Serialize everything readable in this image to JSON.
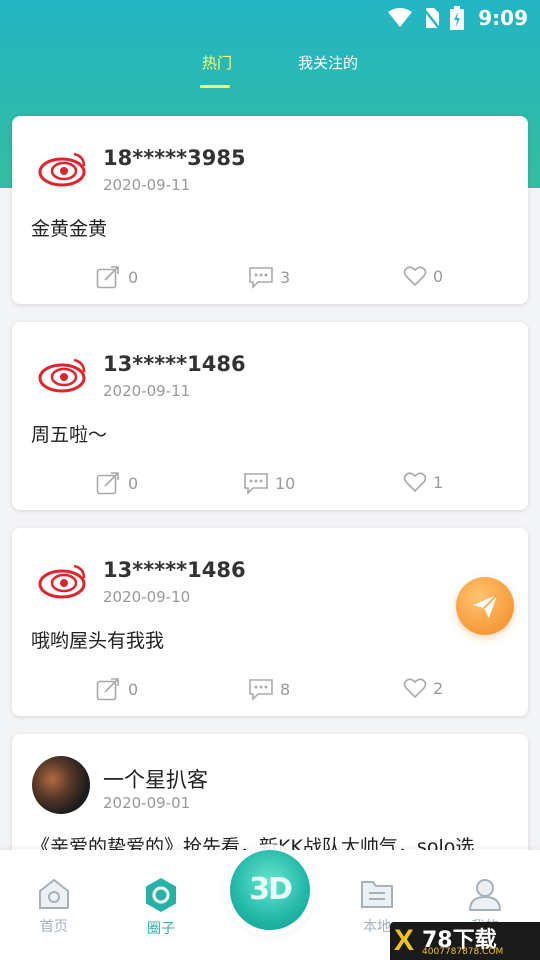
{
  "status_bar": {
    "time": "9:09",
    "icons": [
      "wifi-icon",
      "no-sim-icon",
      "battery-charging-icon"
    ]
  },
  "tabs": [
    {
      "label": "热门",
      "active": true
    },
    {
      "label": "我关注的",
      "active": false
    }
  ],
  "posts": [
    {
      "user": "18*****3985",
      "date": "2020-09-11",
      "text": "金黄金黄",
      "shares": "0",
      "comments": "3",
      "likes": "0",
      "avatar": "weibo-logo"
    },
    {
      "user": "13*****1486",
      "date": "2020-09-11",
      "text": "周五啦～",
      "shares": "0",
      "comments": "10",
      "likes": "1",
      "avatar": "weibo-logo"
    },
    {
      "user": "13*****1486",
      "date": "2020-09-10",
      "text": "哦哟屋头有我我",
      "shares": "0",
      "comments": "8",
      "likes": "2",
      "avatar": "weibo-logo"
    },
    {
      "user": "一个星扒客",
      "date": "2020-09-01",
      "text": "《亲爱的挚爱的》抢先看，新KK战队太帅气，solo选",
      "avatar": "photo"
    }
  ],
  "bottom_nav": {
    "items": [
      {
        "label": "首页",
        "icon": "home-icon",
        "active": false
      },
      {
        "label": "圈子",
        "icon": "circle-icon",
        "active": true
      },
      {
        "label": "3D",
        "icon": "3d-icon",
        "active": false
      },
      {
        "label": "本地",
        "icon": "folder-list-icon",
        "active": false
      },
      {
        "label": "我的",
        "icon": "user-icon",
        "active": false
      }
    ]
  },
  "watermark": {
    "title": "78下载",
    "subtitle": "4007787878.COM"
  },
  "colors": {
    "accent": "#2fb6a7",
    "tab_active": "#fff96b",
    "fab": "#f59a3b"
  }
}
